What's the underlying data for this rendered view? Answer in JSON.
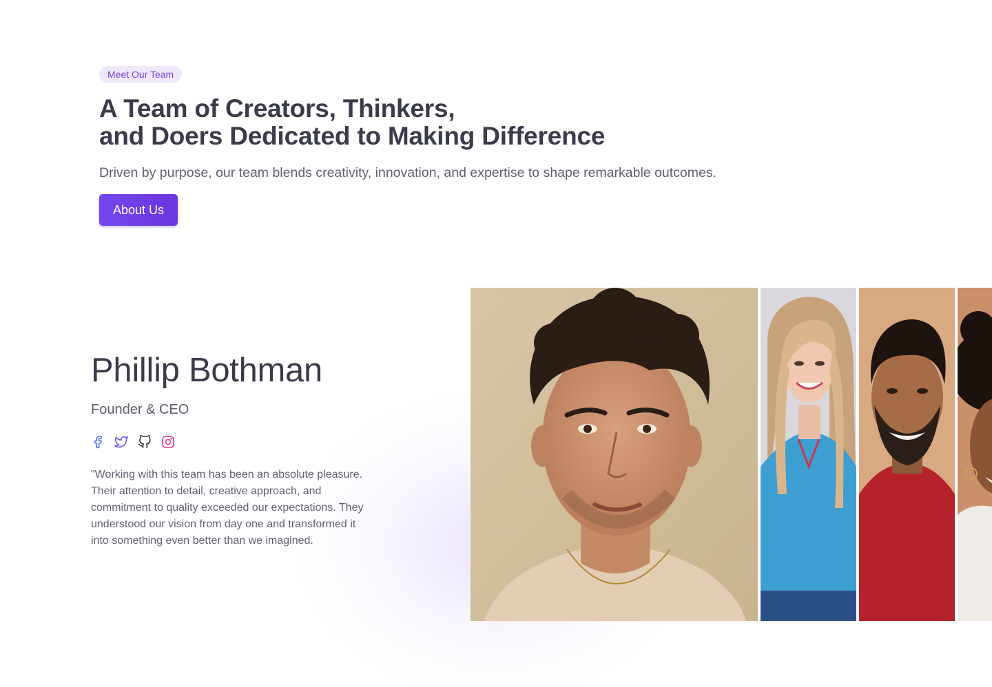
{
  "hero": {
    "badge": "Meet Our Team",
    "title_line1": "A Team of Creators, Thinkers,",
    "title_line2": "and Doers Dedicated to Making Difference",
    "subtitle": "Driven by purpose, our team blends creativity, innovation, and expertise to shape remarkable outcomes.",
    "cta_label": "About Us"
  },
  "profile": {
    "name": "Phillip Bothman",
    "role": "Founder & CEO",
    "quote": "\"Working with this team has been an absolute pleasure. Their attention to detail, creative approach, and commitment to quality exceeded our expectations. They understood our vision from day one and transformed it into something even better than we imagined.",
    "socials": [
      {
        "icon": "facebook-icon",
        "color": "#4a6cf7"
      },
      {
        "icon": "twitter-icon",
        "color": "#6a48e8"
      },
      {
        "icon": "github-icon",
        "color": "#2b2d36"
      },
      {
        "icon": "instagram-icon",
        "color": "#e0308a"
      }
    ]
  },
  "gallery": {
    "photos": [
      {
        "alt": "Phillip Bothman portrait",
        "active": true
      },
      {
        "alt": "team member portrait - woman with blonde hair",
        "active": false
      },
      {
        "alt": "team member portrait - smiling man with beard",
        "active": false
      },
      {
        "alt": "team member portrait - woman with curly hair",
        "active": false
      }
    ]
  },
  "colors": {
    "accent": "#6d3fe6",
    "badge_bg": "#efe8fc",
    "heading": "#3a3c4b",
    "body_text": "#5d6070"
  }
}
